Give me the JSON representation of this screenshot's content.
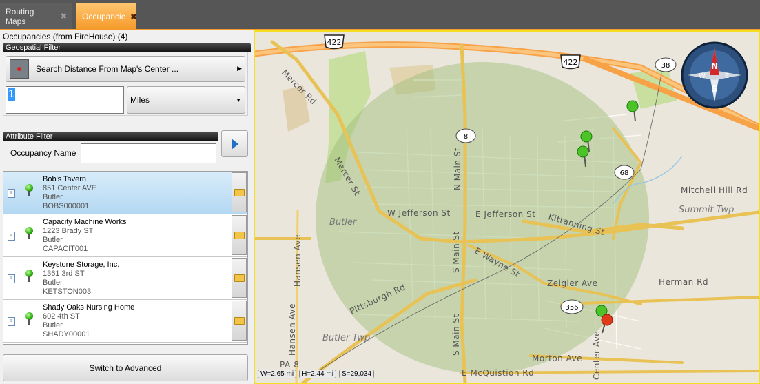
{
  "tabs": [
    {
      "label": "Routing Maps",
      "active": false
    },
    {
      "label": "Occupancie",
      "active": true
    }
  ],
  "panel": {
    "title": "Occupancies (from FireHouse) (4)",
    "geo_header": "Geospatial Filter",
    "search_button": "Search Distance From Map's Center ...",
    "distance_value": "1",
    "units_value": "Miles",
    "attr_header": "Attribute Filter",
    "occupancy_name_label": "Occupancy Name",
    "occupancy_name_value": "",
    "switch_button": "Switch to Advanced"
  },
  "occupancies": [
    {
      "name": "Bob's Tavern",
      "address": "851 Center AVE",
      "city": "Butler",
      "code": "BOBS000001",
      "selected": true
    },
    {
      "name": "Capacity Machine Works",
      "address": "1223 Brady ST",
      "city": "Butler",
      "code": "CAPACIT001",
      "selected": false
    },
    {
      "name": "Keystone Storage, Inc.",
      "address": "1361 3rd ST",
      "city": "Butler",
      "code": "KETSTON003",
      "selected": false
    },
    {
      "name": "Shady Oaks Nursing Home",
      "address": "602 4th ST",
      "city": "Butler",
      "code": "SHADY00001",
      "selected": false
    }
  ],
  "map": {
    "scale_w": "W=2.65 mi",
    "scale_h": "H=2.44 mi",
    "scale_s": "S=29,034",
    "shields": [
      "422",
      "422",
      "38",
      "8",
      "68",
      "356"
    ],
    "labels": {
      "mercer_rd": "Mercer Rd",
      "mercer_st": "Mercer St",
      "n_main": "N Main St",
      "s_main_1": "S Main St",
      "s_main_2": "S Main St",
      "w_jefferson": "W Jefferson St",
      "e_jefferson": "E Jefferson St",
      "kittanning": "Kittanning St",
      "mitchell": "Mitchell Hill Rd",
      "summit": "Summit Twp",
      "butler": "Butler",
      "hansen": "Hansen Ave",
      "e_wayne": "E Wayne St",
      "zeigler": "Zeigler Ave",
      "herman": "Herman Rd",
      "pittsburgh": "Pittsburgh Rd",
      "butler_twp": "Butler Twp",
      "morton": "Morton Ave",
      "center": "Center Ave",
      "mcquistion": "E McQuistion Rd",
      "pa8": "PA-8"
    },
    "compass": {
      "n": "N",
      "e": "E",
      "s": "S",
      "w": "W"
    },
    "colors": {
      "radius_fill": "#9cbf7a",
      "accent": "#f59a2a",
      "highlight": "#f4e020"
    }
  }
}
